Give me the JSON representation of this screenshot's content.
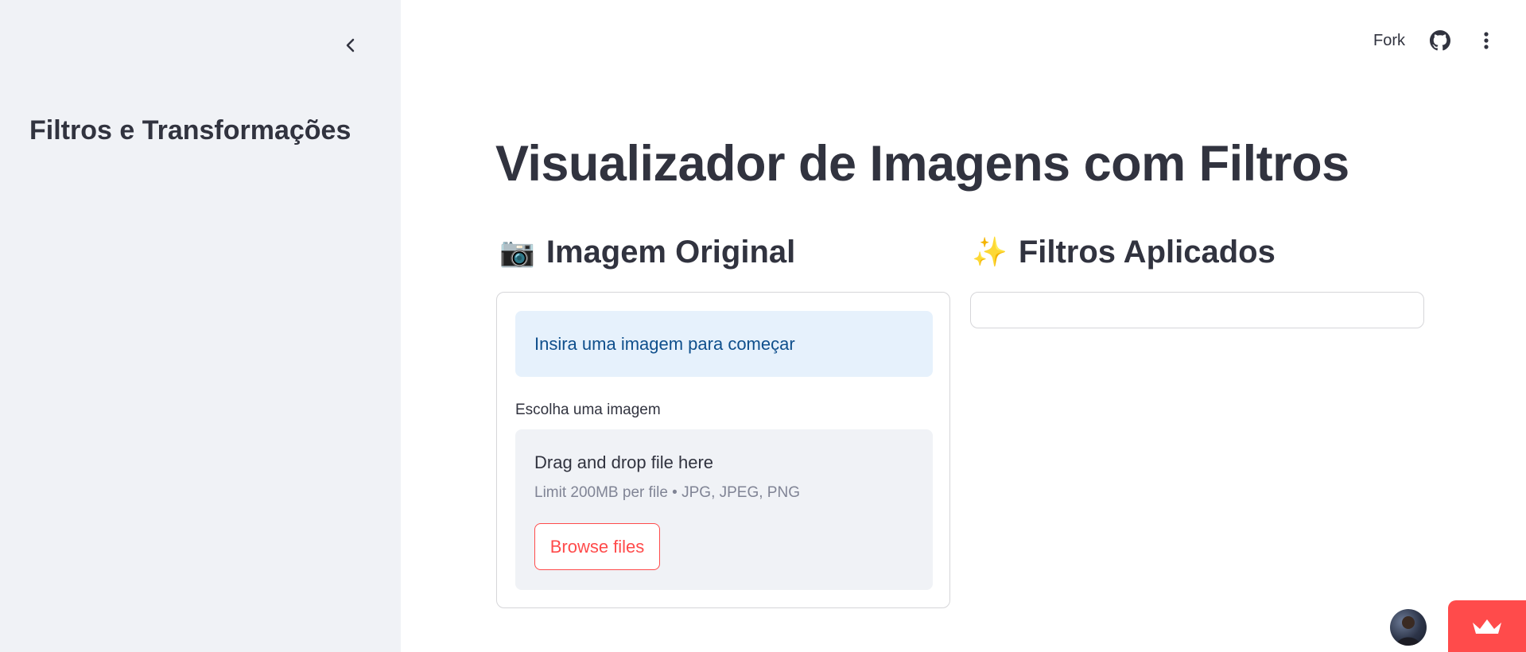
{
  "sidebar": {
    "title": "Filtros e Transformações",
    "collapse_icon": "chevron-left-icon"
  },
  "toolbar": {
    "fork_label": "Fork",
    "github_icon": "github-icon",
    "menu_icon": "kebab-menu-icon"
  },
  "main": {
    "title": "Visualizador de Imagens com Filtros",
    "left_column": {
      "emoji": "📷",
      "heading": "Imagem Original",
      "info_message": "Insira uma imagem para começar",
      "uploader": {
        "label": "Escolha uma imagem",
        "drop_text": "Drag and drop file here",
        "limit_text": "Limit 200MB per file • JPG, JPEG, PNG",
        "browse_label": "Browse files"
      }
    },
    "right_column": {
      "emoji": "✨",
      "heading": "Filtros Aplicados"
    }
  },
  "footer": {
    "avatar_icon": "avatar",
    "badge_icon": "crown-icon"
  },
  "colors": {
    "sidebar_bg": "#f0f2f6",
    "text": "#31333f",
    "accent": "#ff4b4b",
    "info_bg": "#e6f1fc",
    "info_text": "#0f4f8c"
  }
}
